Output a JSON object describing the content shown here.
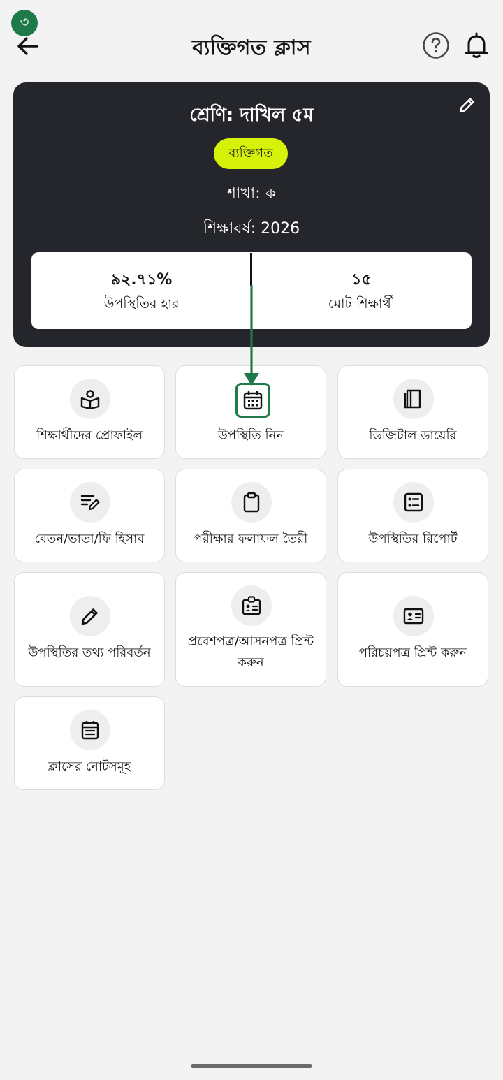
{
  "step_badge": "৩",
  "header": {
    "title": "ব্যক্তিগত ক্লাস"
  },
  "class_card": {
    "class_name": "শ্রেণি: দাখিল ৫ম",
    "type_chip": "ব্যক্তিগত",
    "branch": "শাখা: ক",
    "session": "শিক্ষাবর্ষ: 2026",
    "stats": [
      {
        "value": "৯২.৭১%",
        "label": "উপস্থিতির হার"
      },
      {
        "value": "১৫",
        "label": "মোট শিক্ষার্থী"
      }
    ]
  },
  "accent_color": "#1f7a4a",
  "chip_color": "#d7f20a",
  "menu": [
    {
      "label": "শিক্ষার্থীদের প্রোফাইল",
      "icon": "student-profile-icon"
    },
    {
      "label": "উপস্থিতি নিন",
      "icon": "calendar-icon"
    },
    {
      "label": "ডিজিটাল ডায়েরি",
      "icon": "book-icon"
    },
    {
      "label": "বেতন/ভাতা/ফি হিসাব",
      "icon": "edit-note-icon"
    },
    {
      "label": "পরীক্ষার ফলাফল তৈরী",
      "icon": "clipboard-icon"
    },
    {
      "label": "উপস্থিতির রিপোর্ট",
      "icon": "list-report-icon"
    },
    {
      "label": "উপস্থিতির তথ্য পরিবর্তন",
      "icon": "pencil-icon"
    },
    {
      "label": "প্রবেশপত্র/আসনপত্র প্রিন্ট করুন",
      "icon": "badge-icon"
    },
    {
      "label": "পরিচয়পত্র প্রিন্ট করুন",
      "icon": "id-card-icon"
    },
    {
      "label": "ক্লাসের নোটসমূহ",
      "icon": "notes-icon"
    }
  ]
}
